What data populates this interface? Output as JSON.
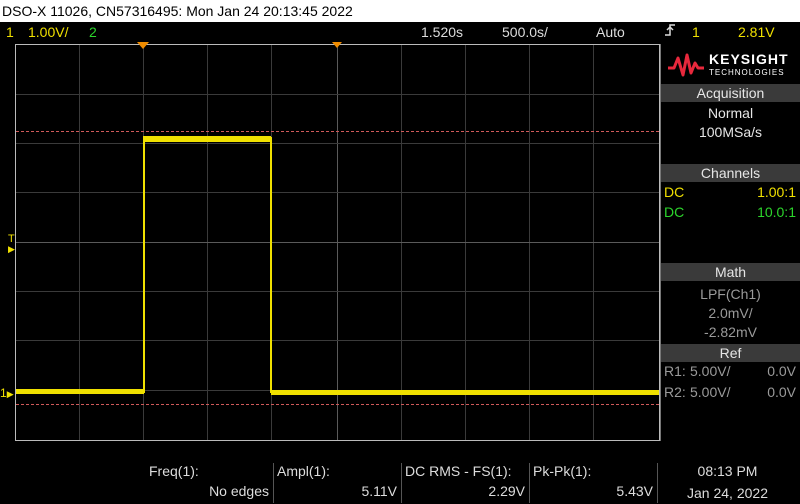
{
  "title_bar": {
    "text": "DSO-X 11026, CN57316495: Mon Jan 24 20:13:45 2022"
  },
  "status": {
    "ch1_num": "1",
    "ch1_scale": "1.00V/",
    "ch2_num": "2",
    "time_delay": "1.520s",
    "time_scale": "500.0s/",
    "trigger_mode": "Auto",
    "trigger_channel": "1",
    "trigger_level": "2.81V"
  },
  "brand": {
    "name": "KEYSIGHT",
    "subtitle": "TECHNOLOGIES"
  },
  "acquisition": {
    "heading": "Acquisition",
    "mode": "Normal",
    "rate": "100MSa/s"
  },
  "channels": {
    "heading": "Channels",
    "items": [
      {
        "coupling": "DC",
        "probe": "1.00:1",
        "color": "#f0e000"
      },
      {
        "coupling": "DC",
        "probe": "10.0:1",
        "color": "#2cd52c"
      }
    ]
  },
  "math": {
    "heading": "Math",
    "func": "LPF(Ch1)",
    "scale": "2.0mV/",
    "offset": "-2.82mV"
  },
  "ref": {
    "heading": "Ref",
    "items": [
      {
        "name": "R1:",
        "scale": "5.00V/",
        "offset": "0.0V"
      },
      {
        "name": "R2:",
        "scale": "5.00V/",
        "offset": "0.0V"
      }
    ]
  },
  "markers": {
    "trigger_T": "T",
    "ch1_marker": "1"
  },
  "measurements": [
    {
      "label": "Freq(1):",
      "value": "No edges"
    },
    {
      "label": "Ampl(1):",
      "value": "5.11V"
    },
    {
      "label": "DC RMS - FS(1):",
      "value": "2.29V"
    },
    {
      "label": "Pk-Pk(1):",
      "value": "5.43V"
    }
  ],
  "clock": {
    "time": "08:13 PM",
    "date": "Jan 24, 2022"
  },
  "colors": {
    "ch1": "#f0e000",
    "ch2": "#2cd52c",
    "cursor": "#d05a5a",
    "accent": "#f08c00"
  }
}
